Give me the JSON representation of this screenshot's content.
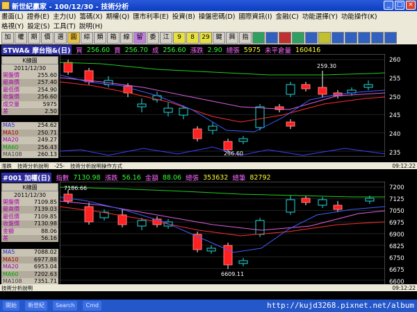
{
  "window": {
    "title": "新世紀贏家 - 100/12/30 - 技術分析"
  },
  "menu": {
    "row1": [
      "畫面(L)",
      "證券(E)",
      "主力(U)",
      "籌碼(X)",
      "期權(Q)",
      "匯市利率(E)",
      "投資(B)",
      "操盤密碼(D)",
      "國際資訊(I)",
      "金融(C)",
      "功能選擇(Y)",
      "功能操作(K)"
    ],
    "row2": [
      "格視(Y)",
      "設定(S)",
      "工具(T)",
      "說明(H)"
    ]
  },
  "toolbar": [
    "加",
    "權",
    "期",
    "價",
    "選",
    "圓",
    "綜",
    "類",
    "箱",
    "線",
    "留",
    "委",
    "江",
    "9",
    "8",
    "29",
    "鍵",
    "興",
    "指",
    "",
    "",
    "",
    "",
    "",
    "",
    "",
    "",
    "",
    "",
    ""
  ],
  "top": {
    "symbol": "STWA& 摩台指&(日)",
    "buy_label": "買",
    "buy": "256.60",
    "sell_label": "賣",
    "sell": "256.70",
    "deal_label": "成",
    "deal": "256.60",
    "chg_label": "漲跌",
    "chg": "2.90",
    "vol_label": "總張",
    "vol": "5975",
    "oi_label": "未平倉量",
    "oi": "160416",
    "kbox": "K線圖",
    "date": "2011/12/30",
    "rows": [
      {
        "k": "開盤價",
        "v": "255.60"
      },
      {
        "k": "最高價",
        "v": "257.40"
      },
      {
        "k": "最低價",
        "v": "254.90"
      },
      {
        "k": "收盤價",
        "v": "256.60"
      },
      {
        "k": "成交量",
        "v": "5975"
      },
      {
        "k": "差",
        "v": "2.50"
      }
    ],
    "ma": [
      {
        "k": "MA5",
        "v": "254.62"
      },
      {
        "k": "MA10",
        "v": "250.71"
      },
      {
        "k": "MA20",
        "v": "249.27"
      },
      {
        "k": "MA60",
        "v": "256.43"
      },
      {
        "k": "MA108",
        "v": "260.13"
      }
    ],
    "yticks": [
      "260",
      "255",
      "250",
      "245",
      "240",
      "235"
    ],
    "high_label": "259.30",
    "low_label": "236.60",
    "strip": [
      "漲跌",
      "技術分析說明",
      "-25-",
      "技術分析說明操作方式"
    ],
    "time": "09:12:22"
  },
  "bottom": {
    "symbol": "#001 加權(日)",
    "idx_label": "指數",
    "idx": "7130.98",
    "chg_label": "漲跌",
    "chg": "56.16",
    "amt_label": "金額",
    "amt": "88.06",
    "vol_label": "總張",
    "vol": "353632",
    "cnt_label": "總筆",
    "cnt": "82792",
    "kbox": "K線圖",
    "date": "2011/12/30",
    "rows": [
      {
        "k": "開盤價",
        "v": "7109.85"
      },
      {
        "k": "最高價",
        "v": "7139.03"
      },
      {
        "k": "最低價",
        "v": "7109.85"
      },
      {
        "k": "收盤價",
        "v": "7130.98"
      },
      {
        "k": "金額",
        "v": "88.06"
      },
      {
        "k": "差",
        "v": "56.16"
      }
    ],
    "ma": [
      {
        "k": "MA5",
        "v": "7088.02"
      },
      {
        "k": "MA10",
        "v": "6977.88"
      },
      {
        "k": "MA20",
        "v": "6953.04"
      },
      {
        "k": "MA60",
        "v": "7202.63"
      },
      {
        "k": "MA108",
        "v": "7351.71"
      }
    ],
    "yticks": [
      "7200",
      "7125",
      "7050",
      "6975",
      "6900",
      "6825",
      "6750",
      "6675",
      "6600"
    ],
    "high_label": "7186.66",
    "low_label": "6609.11",
    "strip": [
      "技術分析說明"
    ],
    "time": "09:12:22"
  },
  "taskbar": [
    "開始",
    "新世紀",
    "Search",
    "Cmd"
  ],
  "watermark": "http://kujd3268.pixnet.net/album"
}
